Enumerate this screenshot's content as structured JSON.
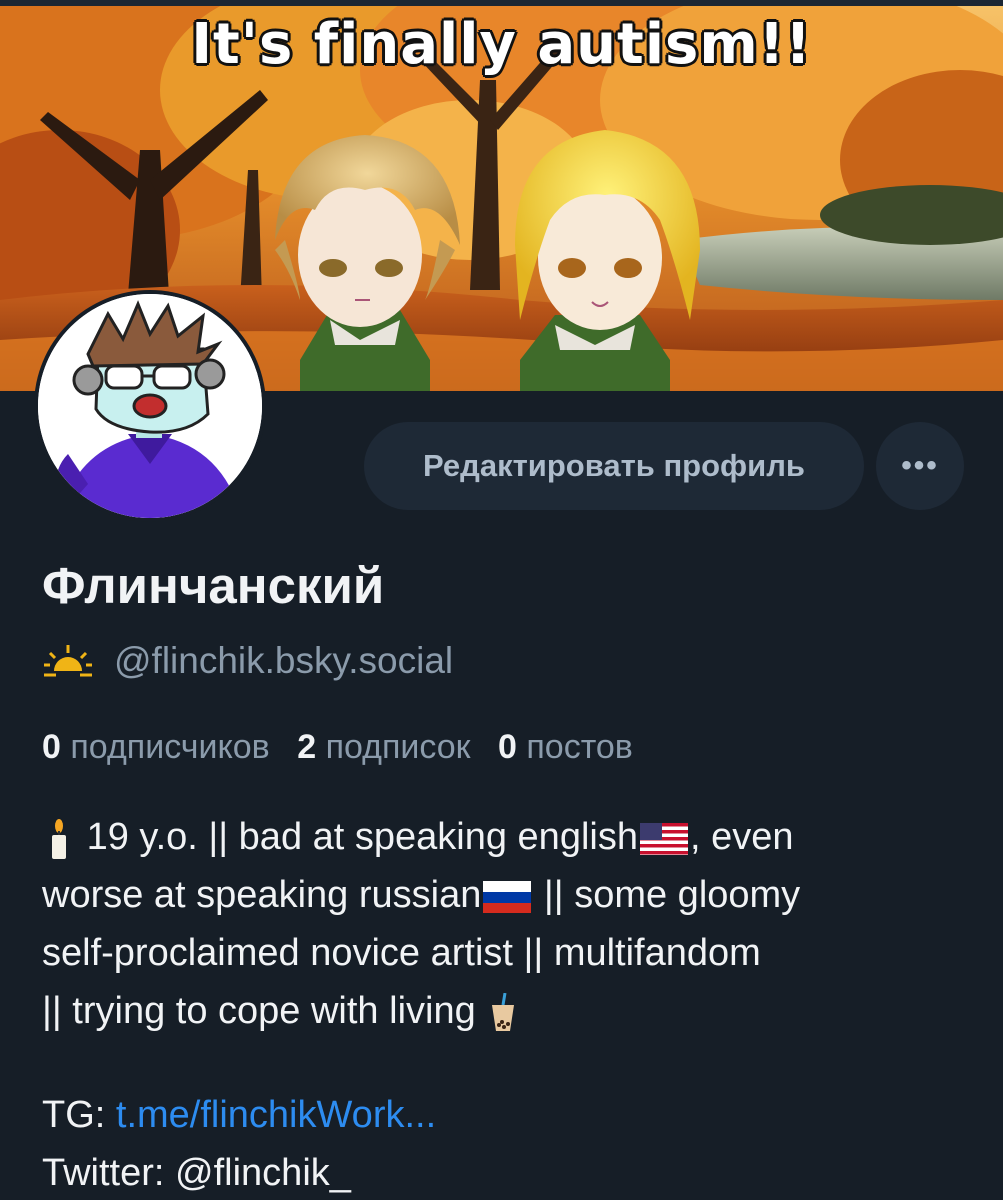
{
  "banner": {
    "caption": "It's finally autism!!"
  },
  "actions": {
    "edit_profile": "Редактировать профиль",
    "more": "•••"
  },
  "profile": {
    "display_name": "Флинчанский",
    "handle": "@flinchik.bsky.social"
  },
  "stats": {
    "followers_count": "0",
    "followers_label": "подписчиков",
    "following_count": "2",
    "following_label": "подписок",
    "posts_count": "0",
    "posts_label": "постов"
  },
  "bio": {
    "line1_a": "19 y.o. || bad at speaking english",
    "line1_b": ", even",
    "line2_a": "worse at speaking russian",
    "line2_b": " || some gloomy",
    "line3": "self-proclaimed novice artist || multifandom",
    "line4": "|| trying to cope with living"
  },
  "links": {
    "tg_label": "TG: ",
    "tg_link": "t.me/flinchikWork...",
    "twitter_label": "Twitter: ",
    "twitter_handle": "@flinchik_"
  },
  "icons": {
    "sun": "sunrise-icon",
    "candle": "candle-icon",
    "us_flag": "us-flag-icon",
    "ru_flag": "russia-flag-icon",
    "bubble_tea": "bubble-tea-icon",
    "more": "more-dots-icon"
  },
  "colors": {
    "background": "#161e27",
    "button_bg": "#1e2936",
    "muted_text": "#8b9bab",
    "link": "#2d8cf0"
  }
}
